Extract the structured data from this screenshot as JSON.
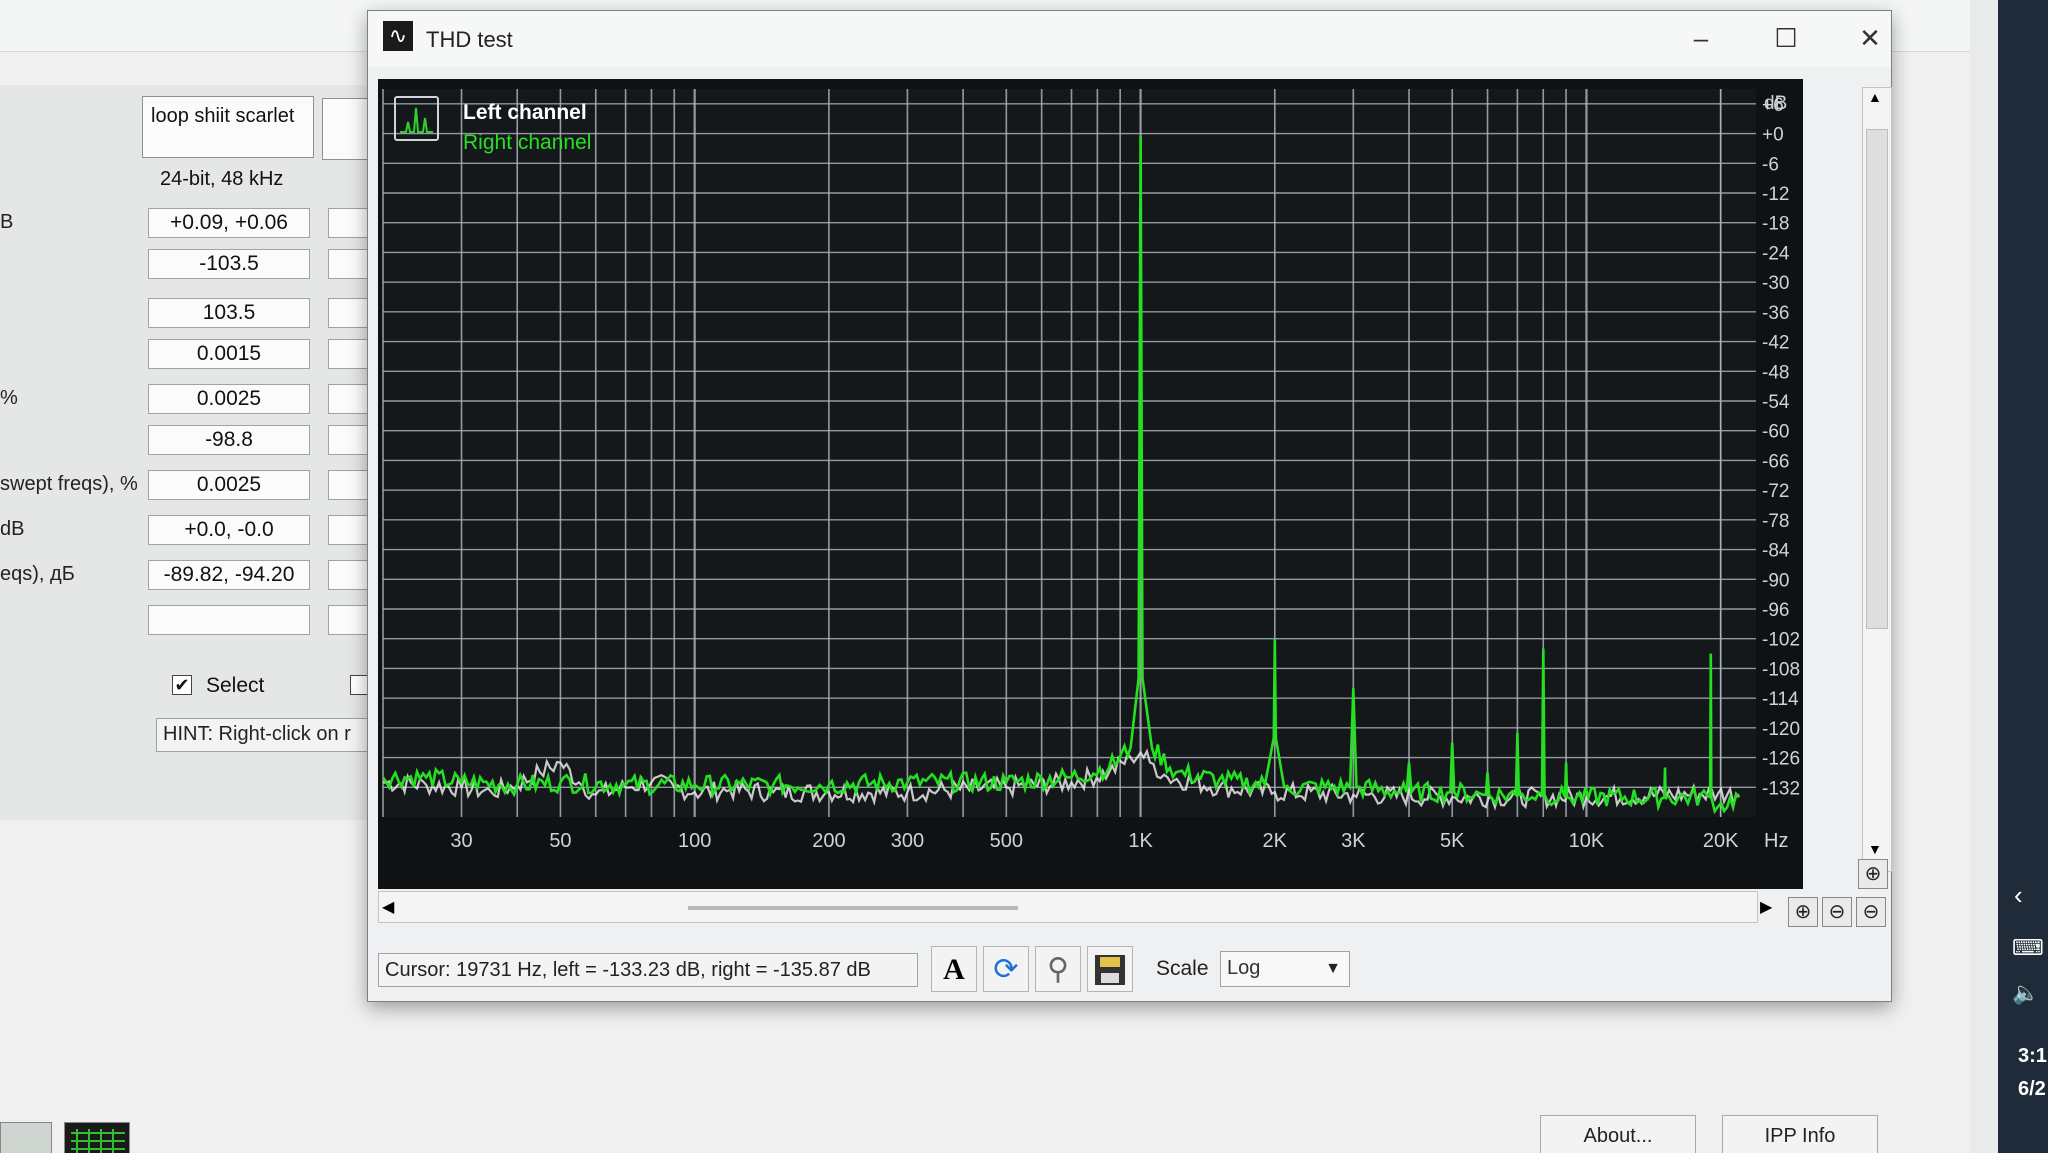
{
  "thd_window": {
    "title": "THD test",
    "legend": {
      "left": "Left channel",
      "right": "Right channel"
    },
    "cursor_readout": "Cursor:  19731 Hz,  left = -133.23 dB,  right = -135.87 dB",
    "scale_label": "Scale",
    "scale_value": "Log",
    "colors": {
      "left_trace": "#e8e8e8",
      "right_trace": "#25e020",
      "plot_bg": "#0f1113",
      "grid": "#a9b0b8"
    }
  },
  "background_panel": {
    "device_name": "loop shiit scarlet",
    "format": "24-bit, 48 kHz",
    "rows": [
      {
        "label": "B",
        "value": "+0.09, +0.06"
      },
      {
        "label": "",
        "value": "-103.5"
      },
      {
        "label": "",
        "value": "103.5"
      },
      {
        "label": "",
        "value": "0.0015"
      },
      {
        "label": "%",
        "value": "0.0025"
      },
      {
        "label": "",
        "value": "-98.8"
      },
      {
        "label": "swept freqs), %",
        "value": "0.0025"
      },
      {
        "label": "dB",
        "value": "+0.0, -0.0"
      },
      {
        "label": "eqs), дБ",
        "value": "-89.82, -94.20"
      },
      {
        "label": "",
        "value": ""
      }
    ],
    "select_label": "Select",
    "select_checked": true,
    "hint": "HINT: Right-click on r",
    "about_button": "About...",
    "ipp_button": "IPP Info"
  },
  "taskbar": {
    "time": "3:1",
    "date": "6/2"
  },
  "chart_data": {
    "type": "line",
    "title": "",
    "xlabel": "Hz",
    "ylabel": "dB",
    "x_scale": "log",
    "xlim": [
      20,
      24000
    ],
    "ylim": [
      -138,
      9
    ],
    "x_ticks": [
      {
        "label": "30",
        "v": 30
      },
      {
        "label": "50",
        "v": 50
      },
      {
        "label": "100",
        "v": 100
      },
      {
        "label": "200",
        "v": 200
      },
      {
        "label": "300",
        "v": 300
      },
      {
        "label": "500",
        "v": 500
      },
      {
        "label": "1K",
        "v": 1000
      },
      {
        "label": "2K",
        "v": 2000
      },
      {
        "label": "3K",
        "v": 3000
      },
      {
        "label": "5K",
        "v": 5000
      },
      {
        "label": "10K",
        "v": 10000
      },
      {
        "label": "20K",
        "v": 20000
      }
    ],
    "y_ticks": [
      {
        "label": "+6",
        "v": 6
      },
      {
        "label": "+0",
        "v": 0
      },
      {
        "label": "-6",
        "v": -6
      },
      {
        "label": "-12",
        "v": -12
      },
      {
        "label": "-18",
        "v": -18
      },
      {
        "label": "-24",
        "v": -24
      },
      {
        "label": "-30",
        "v": -30
      },
      {
        "label": "-36",
        "v": -36
      },
      {
        "label": "-42",
        "v": -42
      },
      {
        "label": "-48",
        "v": -48
      },
      {
        "label": "-54",
        "v": -54
      },
      {
        "label": "-60",
        "v": -60
      },
      {
        "label": "-66",
        "v": -66
      },
      {
        "label": "-72",
        "v": -72
      },
      {
        "label": "-78",
        "v": -78
      },
      {
        "label": "-84",
        "v": -84
      },
      {
        "label": "-90",
        "v": -90
      },
      {
        "label": "-96",
        "v": -96
      },
      {
        "label": "-102",
        "v": -102
      },
      {
        "label": "-108",
        "v": -108
      },
      {
        "label": "-114",
        "v": -114
      },
      {
        "label": "-120",
        "v": -120
      },
      {
        "label": "-126",
        "v": -126
      },
      {
        "label": "-132",
        "v": -132
      }
    ],
    "grid": true,
    "series": [
      {
        "name": "Left channel",
        "points": [
          [
            20,
            -131
          ],
          [
            25,
            -131.5
          ],
          [
            30,
            -132
          ],
          [
            35,
            -133
          ],
          [
            40,
            -131.5
          ],
          [
            45,
            -129
          ],
          [
            50,
            -127
          ],
          [
            55,
            -131
          ],
          [
            60,
            -133.5
          ],
          [
            70,
            -132
          ],
          [
            80,
            -131
          ],
          [
            90,
            -132
          ],
          [
            100,
            -133
          ],
          [
            120,
            -132.5
          ],
          [
            150,
            -133
          ],
          [
            200,
            -133
          ],
          [
            300,
            -133
          ],
          [
            500,
            -132
          ],
          [
            700,
            -131
          ],
          [
            850,
            -129
          ],
          [
            950,
            -126
          ],
          [
            1000,
            -125
          ],
          [
            1050,
            -127
          ],
          [
            1150,
            -130
          ],
          [
            1500,
            -132
          ],
          [
            2000,
            -133
          ],
          [
            3000,
            -133.5
          ],
          [
            5000,
            -134
          ],
          [
            10000,
            -134
          ],
          [
            19731,
            -133.23
          ],
          [
            22000,
            -133.5
          ]
        ]
      },
      {
        "name": "Right channel",
        "points": [
          [
            20,
            -130
          ],
          [
            25,
            -130
          ],
          [
            30,
            -131
          ],
          [
            40,
            -131.5
          ],
          [
            50,
            -131
          ],
          [
            70,
            -131.5
          ],
          [
            100,
            -131.5
          ],
          [
            150,
            -131.5
          ],
          [
            200,
            -131.5
          ],
          [
            300,
            -131
          ],
          [
            500,
            -131
          ],
          [
            700,
            -130
          ],
          [
            850,
            -128
          ],
          [
            950,
            -124
          ],
          [
            990,
            -110
          ],
          [
            1000,
            -0.5
          ],
          [
            1010,
            -110
          ],
          [
            1060,
            -124
          ],
          [
            1200,
            -129
          ],
          [
            1500,
            -130.5
          ],
          [
            1900,
            -131.5
          ],
          [
            1990,
            -122
          ],
          [
            2000,
            -102
          ],
          [
            2010,
            -122
          ],
          [
            2100,
            -132
          ],
          [
            2950,
            -132
          ],
          [
            3000,
            -112
          ],
          [
            3050,
            -132
          ],
          [
            3950,
            -133
          ],
          [
            4000,
            -127
          ],
          [
            4050,
            -133
          ],
          [
            4950,
            -133
          ],
          [
            5000,
            -123
          ],
          [
            5050,
            -133
          ],
          [
            5950,
            -133.5
          ],
          [
            6000,
            -129
          ],
          [
            6050,
            -133.5
          ],
          [
            6950,
            -133.5
          ],
          [
            7000,
            -121
          ],
          [
            7050,
            -133.5
          ],
          [
            7950,
            -133.5
          ],
          [
            8000,
            -104
          ],
          [
            8050,
            -133.5
          ],
          [
            8950,
            -134
          ],
          [
            9000,
            -127
          ],
          [
            9050,
            -134
          ],
          [
            14950,
            -134
          ],
          [
            15000,
            -128
          ],
          [
            15050,
            -134
          ],
          [
            18950,
            -134
          ],
          [
            19000,
            -105
          ],
          [
            19050,
            -134
          ],
          [
            19731,
            -135.87
          ],
          [
            22000,
            -134
          ]
        ]
      }
    ]
  }
}
